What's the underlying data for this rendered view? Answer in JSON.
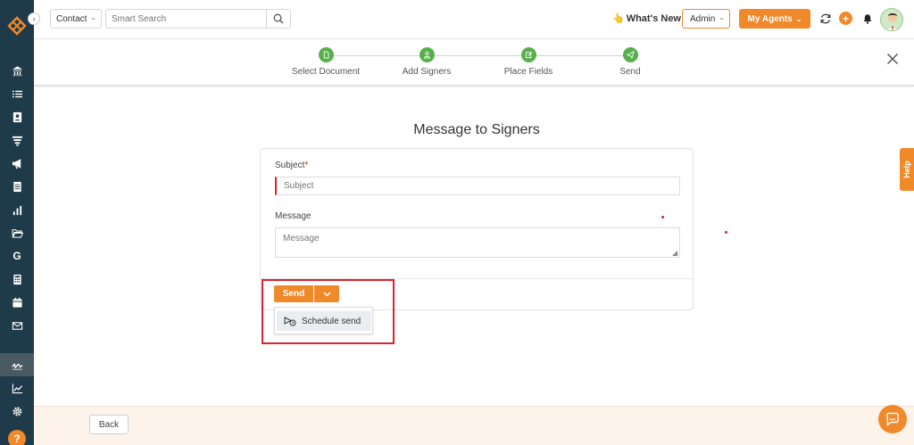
{
  "topbar": {
    "contact_label": "Contact",
    "search_placeholder": "Smart Search",
    "whats_new_label": "What's New",
    "admin_label": "Admin",
    "agents_label": "My Agents"
  },
  "steps": [
    {
      "label": "Select Document",
      "icon": "document-icon"
    },
    {
      "label": "Add Signers",
      "icon": "user-icon"
    },
    {
      "label": "Place Fields",
      "icon": "edit-icon"
    },
    {
      "label": "Send",
      "icon": "paper-plane-icon"
    }
  ],
  "main": {
    "heading": "Message to Signers",
    "subject_label": "Subject",
    "subject_required_mark": "*",
    "subject_placeholder": "Subject",
    "message_label": "Message",
    "message_placeholder": "Message"
  },
  "send": {
    "send_label": "Send",
    "schedule_label": "Schedule send"
  },
  "help_tab_label": "Help",
  "footer": {
    "back_label": "Back"
  },
  "colors": {
    "accent": "#f0892a",
    "sidebar": "#1f3a48",
    "step_done": "#57b04a",
    "highlight": "#d9232d"
  }
}
